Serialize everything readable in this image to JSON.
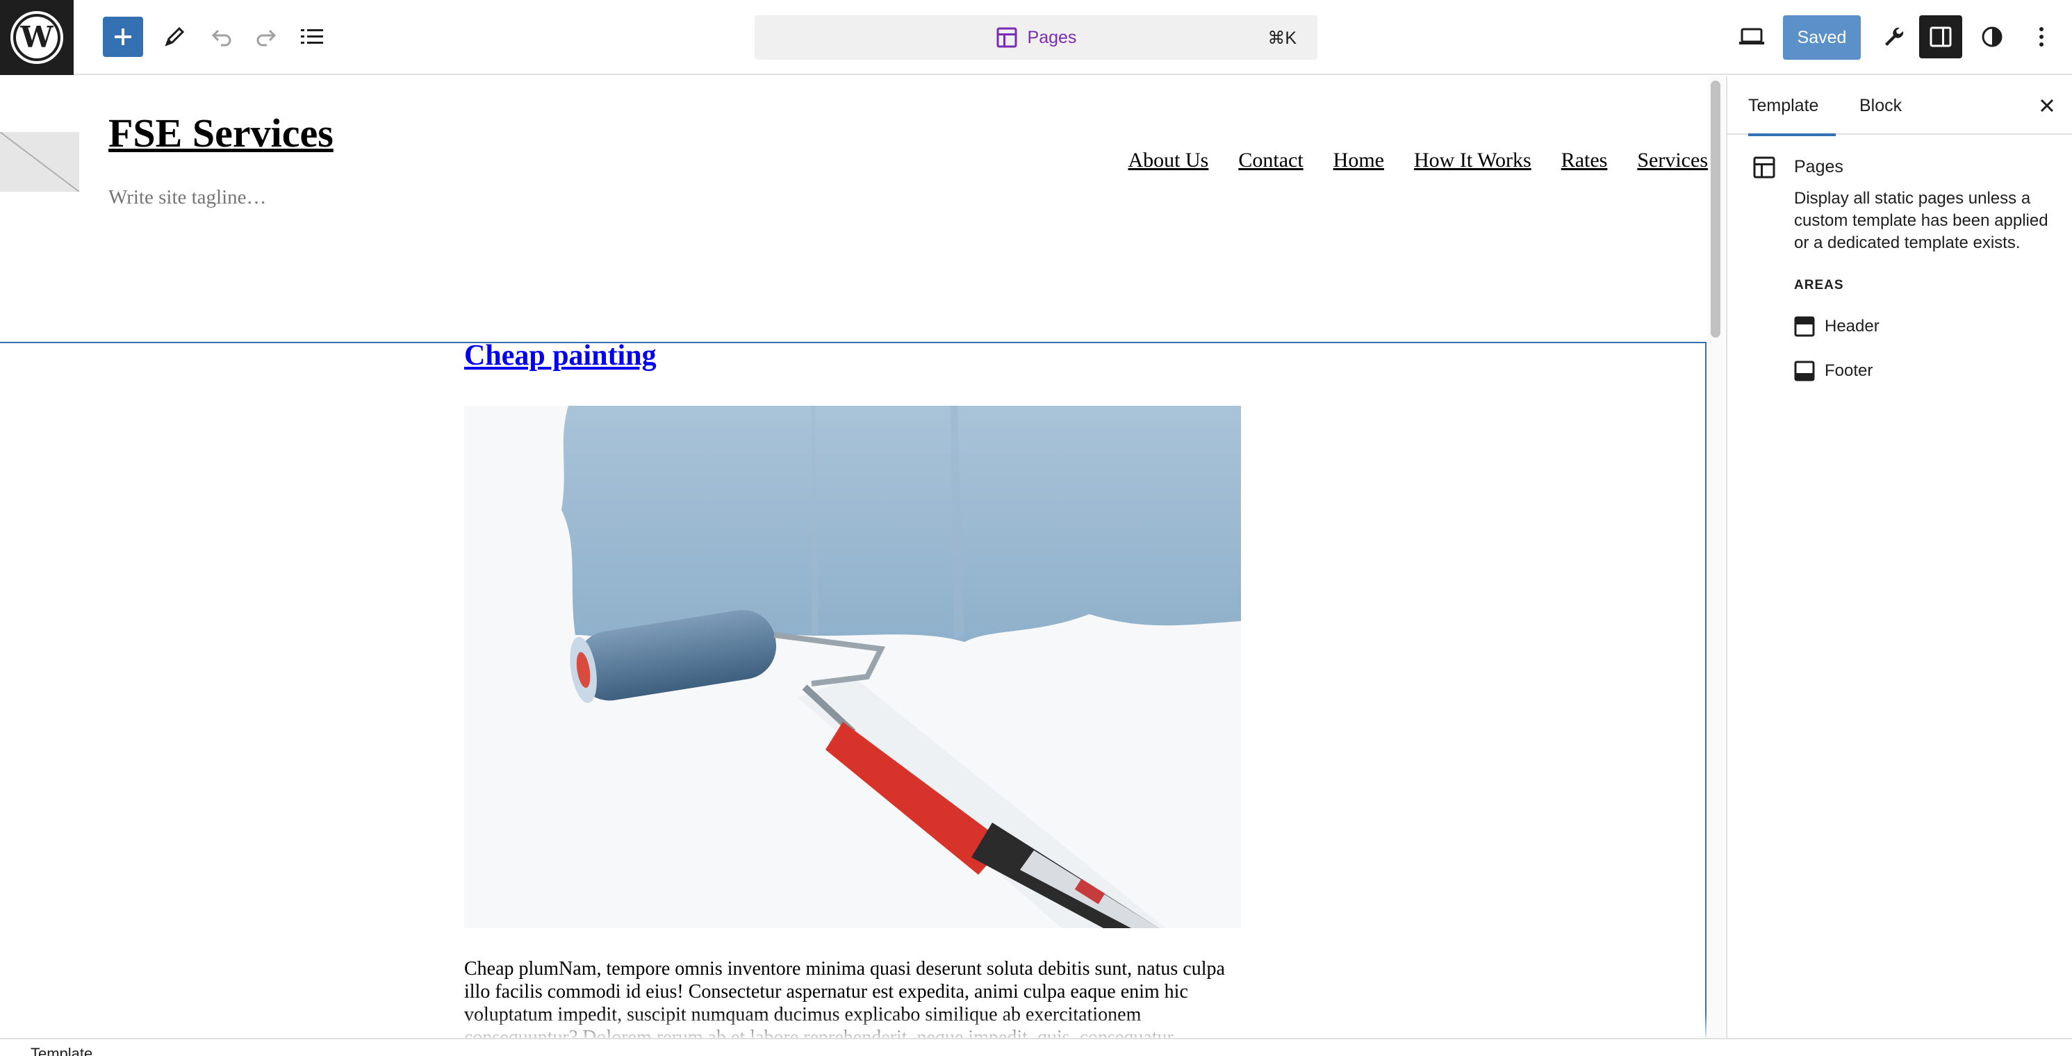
{
  "toolbar": {
    "command_label": "Pages",
    "command_shortcut": "⌘K",
    "saved_label": "Saved",
    "icons": [
      "wordpress-icon",
      "plus-icon",
      "pencil-icon",
      "undo-icon",
      "redo-icon",
      "list-view-icon",
      "layout-icon",
      "desktop-icon",
      "wrench-icon",
      "sidebar-icon",
      "contrast-icon",
      "more-vertical-icon"
    ]
  },
  "site": {
    "title": "FSE Services",
    "tagline": "Write site tagline…",
    "nav": [
      "About Us",
      "Contact",
      "Home",
      "How It Works",
      "Rates",
      "Services"
    ]
  },
  "post": {
    "title": "Cheap painting",
    "excerpt": "Cheap plumNam, tempore omnis inventore minima quasi deserunt soluta debitis sunt, natus culpa illo facilis commodi id eius! Consectetur aspernatur est expedita, animi culpa eaque enim hic voluptatum impedit, suscipit numquam ducimus explicabo similique ab exercitationem consequuntur? Dolorem rerum ab et labore reprehenderit, neque impedit, quis, consequatur maiores."
  },
  "sidebar": {
    "tabs": [
      "Template",
      "Block"
    ],
    "active_tab": "Template",
    "template_title": "Pages",
    "template_desc": "Display all static pages unless a custom template has been applied or a dedicated template exists.",
    "areas_label": "AREAS",
    "areas": [
      "Header",
      "Footer"
    ]
  },
  "footer": {
    "breadcrumb": "Template"
  },
  "colors": {
    "accent": "#3371b2",
    "command_text": "#7a2cb3",
    "saved_bg": "#5b90c9"
  }
}
